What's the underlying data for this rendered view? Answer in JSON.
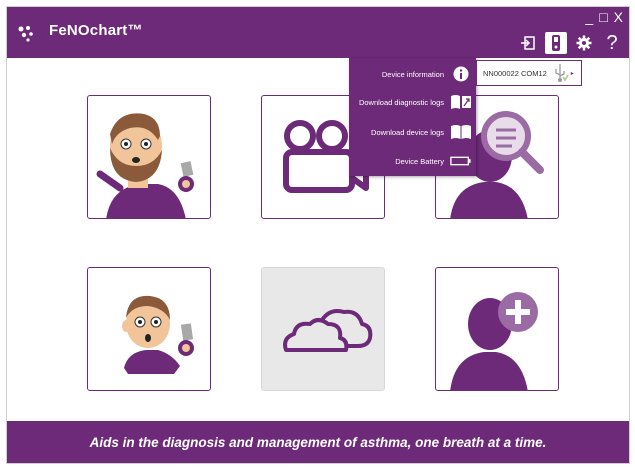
{
  "app": {
    "title": "FeNOchart™",
    "window_controls": {
      "minimize": "_",
      "maximize": "□",
      "close": "X"
    },
    "toolbar": {
      "help": "?"
    }
  },
  "device_menu": {
    "items": [
      {
        "label": "Device information",
        "icon": "info-icon"
      },
      {
        "label": "Download diagnostic logs",
        "icon": "diagnostic-logs-icon"
      },
      {
        "label": "Download device logs",
        "icon": "book-icon"
      },
      {
        "label": "Device Battery",
        "icon": "battery-icon"
      }
    ],
    "device_label": "NN000022 COM12"
  },
  "tiles": [
    {
      "name": "patient-measurement-tile",
      "icon": "bearded-man-device-icon"
    },
    {
      "name": "video-tutorial-tile",
      "icon": "video-camera-icon"
    },
    {
      "name": "search-patient-tile",
      "icon": "search-person-icon"
    },
    {
      "name": "child-measurement-tile",
      "icon": "child-device-icon"
    },
    {
      "name": "cloud-tile",
      "icon": "cloud-icon",
      "disabled": true
    },
    {
      "name": "add-patient-tile",
      "icon": "add-person-icon"
    }
  ],
  "footer": {
    "tagline": "Aids in the diagnosis and management of asthma, one breath at a time."
  },
  "colors": {
    "brand_purple": "#6d2a78",
    "light_purple": "#9b6ba3"
  }
}
